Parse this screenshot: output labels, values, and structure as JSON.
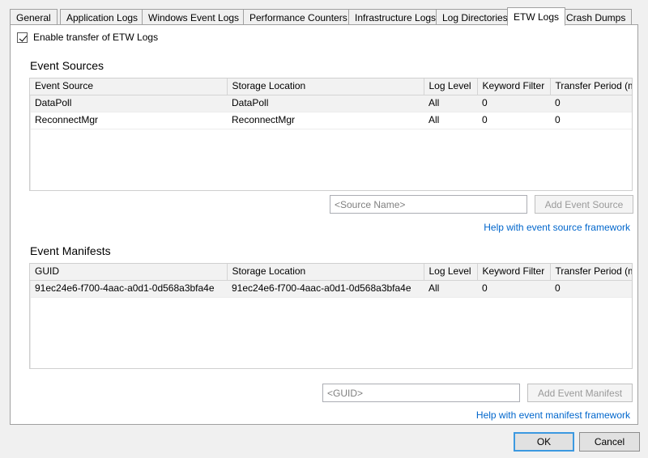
{
  "tabs": [
    {
      "label": "General",
      "active": false
    },
    {
      "label": "Application Logs",
      "active": false
    },
    {
      "label": "Windows Event Logs",
      "active": false
    },
    {
      "label": "Performance Counters",
      "active": false
    },
    {
      "label": "Infrastructure Logs",
      "active": false
    },
    {
      "label": "Log Directories",
      "active": false
    },
    {
      "label": "ETW Logs",
      "active": true
    },
    {
      "label": "Crash Dumps",
      "active": false
    }
  ],
  "enable": {
    "label": "Enable transfer of ETW Logs",
    "checked": true
  },
  "event_sources": {
    "title": "Event Sources",
    "columns": [
      "Event Source",
      "Storage Location",
      "Log Level",
      "Keyword Filter",
      "Transfer Period (min)"
    ],
    "rows": [
      [
        "DataPoll",
        "DataPoll",
        "All",
        "0",
        "0"
      ],
      [
        "ReconnectMgr",
        "ReconnectMgr",
        "All",
        "0",
        "0"
      ]
    ],
    "input_placeholder": "<Source Name>",
    "add_button": "Add Event Source",
    "help_link": "Help with event source framework"
  },
  "event_manifests": {
    "title": "Event Manifests",
    "columns": [
      "GUID",
      "Storage Location",
      "Log Level",
      "Keyword Filter",
      "Transfer Period (min)"
    ],
    "rows": [
      [
        "91ec24e6-f700-4aac-a0d1-0d568a3bfa4e",
        "91ec24e6-f700-4aac-a0d1-0d568a3bfa4e",
        "All",
        "0",
        "0"
      ]
    ],
    "input_placeholder": "<GUID>",
    "add_button": "Add Event Manifest",
    "help_link": "Help with event manifest framework"
  },
  "dialog_buttons": {
    "ok": "OK",
    "cancel": "Cancel"
  },
  "colors": {
    "link": "#0066cc",
    "dialog_background": "#f0f0f0",
    "panel_background": "#ffffff",
    "focus_border": "#3c99e0",
    "header_background": "#f2f2f2"
  }
}
